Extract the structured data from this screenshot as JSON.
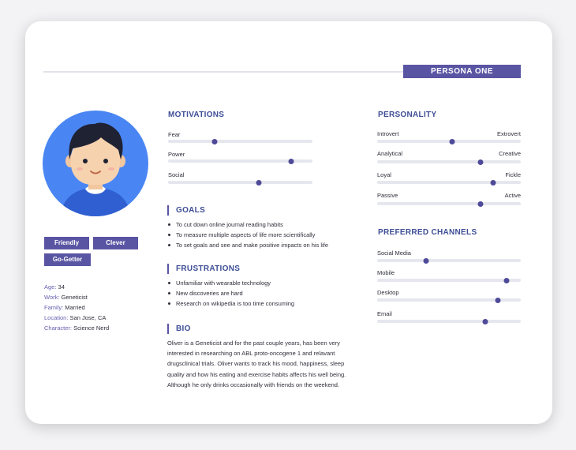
{
  "header": {
    "persona_label": "PERSONA ONE"
  },
  "traits": [
    "Friendly",
    "Clever",
    "Go-Getter"
  ],
  "profile": [
    {
      "key": "Age:",
      "value": "34"
    },
    {
      "key": "Work:",
      "value": "Geneticist"
    },
    {
      "key": "Family:",
      "value": "Married"
    },
    {
      "key": "Location:",
      "value": "San Jose, CA"
    },
    {
      "key": "Character:",
      "value": "Science Nerd"
    }
  ],
  "motivations": {
    "title": "MOTIVATIONS",
    "items": [
      {
        "label": "Fear",
        "level": 0.32
      },
      {
        "label": "Power",
        "level": 0.85
      },
      {
        "label": "Social",
        "level": 0.63
      }
    ]
  },
  "goals": {
    "title": "GOALS",
    "items": [
      "To cut down online journal reading habits",
      "To measure multiple aspects of life more scientifically",
      "To set goals and see and make positive impacts on his life"
    ]
  },
  "frustrations": {
    "title": "FRUSTRATIONS",
    "items": [
      "Unfamiliar with wearable technology",
      "New discoveries are hard",
      "Research on wikipedia is too time consuming"
    ]
  },
  "bio": {
    "title": "BIO",
    "text": "Oliver is a Geneticist and for the past couple years, has been very interested in researching on ABL proto-oncogene 1 and relavant drugsclinical trials. Oliver wants to track his mood, happiness, sleep quality and how his eating and exercise habits affects his well being. Although he only drinks occasionally with friends on the weekend."
  },
  "personality": {
    "title": "PERSONALITY",
    "items": [
      {
        "left": "Introvert",
        "right": "Extrovert",
        "level": 0.52
      },
      {
        "left": "Analytical",
        "right": "Creative",
        "level": 0.72
      },
      {
        "left": "Loyal",
        "right": "Fickle",
        "level": 0.81
      },
      {
        "left": "Passive",
        "right": "Active",
        "level": 0.72
      }
    ]
  },
  "channels": {
    "title": "PREFERRED CHANNELS",
    "items": [
      {
        "label": "Social Media",
        "level": 0.34
      },
      {
        "label": "Mobile",
        "level": 0.9
      },
      {
        "label": "Desktop",
        "level": 0.84
      },
      {
        "label": "Email",
        "level": 0.75
      }
    ]
  },
  "colors": {
    "accent": "#5a55a3",
    "heading": "#3e4e96",
    "avatar_bg": "#4a86f3",
    "track": "#e6e7ee"
  }
}
